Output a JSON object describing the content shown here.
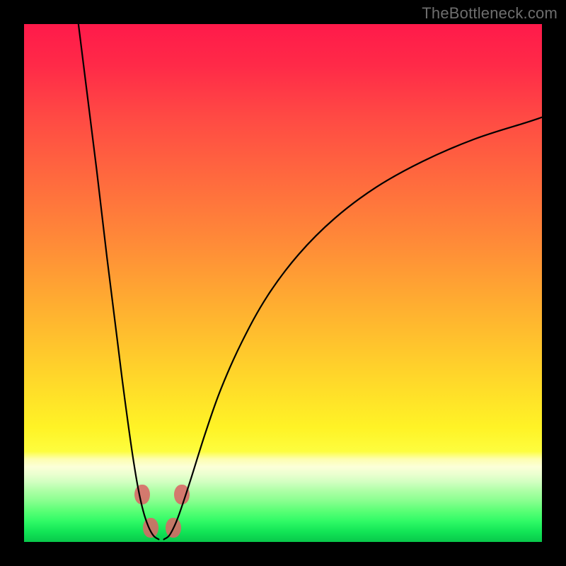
{
  "watermark": "TheBottleneck.com",
  "chart_data": {
    "type": "line",
    "title": "",
    "xlabel": "",
    "ylabel": "",
    "xlim": [
      0,
      100
    ],
    "ylim": [
      0,
      100
    ],
    "grid": false,
    "legend": false,
    "series": [
      {
        "name": "left-branch",
        "x": [
          10.5,
          12,
          14,
          16,
          18,
          19,
          20,
          21,
          22,
          23,
          24,
          25,
          26
        ],
        "y": [
          100,
          88,
          72,
          55,
          39,
          31,
          23.5,
          16.5,
          10.5,
          6.0,
          3.0,
          1.2,
          0.5
        ]
      },
      {
        "name": "right-branch",
        "x": [
          27,
          28,
          29,
          30,
          32,
          35,
          38,
          42,
          47,
          53,
          60,
          68,
          77,
          87,
          97,
          100
        ],
        "y": [
          0.5,
          1.2,
          3.0,
          5.5,
          11.5,
          21,
          29.5,
          38.5,
          47.5,
          55.5,
          62.5,
          68.5,
          73.5,
          77.8,
          81,
          82
        ]
      }
    ],
    "markers": [
      {
        "name": "marker-left-upper",
        "x": 22.8,
        "y": 9.2
      },
      {
        "name": "marker-right-upper",
        "x": 30.4,
        "y": 9.2
      },
      {
        "name": "marker-left-lower",
        "x": 24.4,
        "y": 2.8
      },
      {
        "name": "marker-right-lower",
        "x": 28.8,
        "y": 2.8
      }
    ],
    "background_gradient": {
      "top": "#ff1a4a",
      "mid": "#ffd62a",
      "bottom": "#08c84b"
    }
  }
}
